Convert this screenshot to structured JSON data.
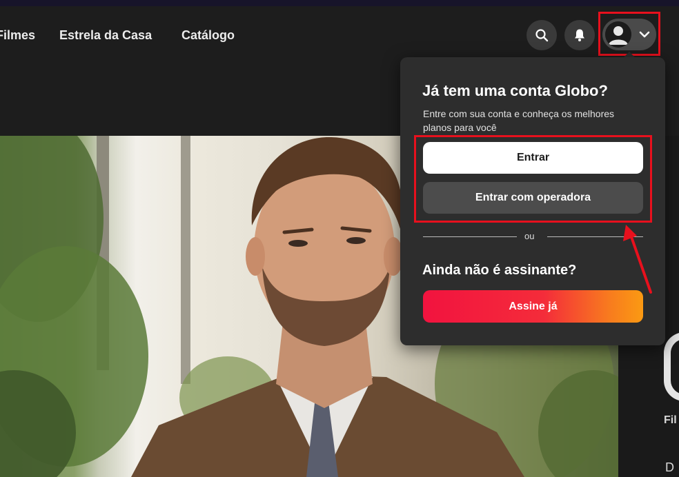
{
  "nav": {
    "links": [
      "Filmes",
      "Estrela da Casa",
      "Catálogo"
    ]
  },
  "header_icons": {
    "search": "search-icon",
    "notifications": "bell-icon",
    "profile": "user-avatar-icon",
    "profile_menu": "chevron-down-icon"
  },
  "login_dropdown": {
    "title": "Já tem uma conta Globo?",
    "subtitle": "Entre com sua conta e conheça os melhores planos para você",
    "login_button": "Entrar",
    "operator_button": "Entrar com operadora",
    "separator": "ou",
    "subscribe_question": "Ainda não é assinante?",
    "subscribe_button": "Assine já"
  },
  "side_panel": {
    "partial_texts": [
      "Fil",
      "D"
    ]
  },
  "colors": {
    "highlight": "#e8101d",
    "subscribe_gradient_start": "#f2133f",
    "subscribe_gradient_end": "#fb9a12",
    "dropdown_bg": "#2d2d2d",
    "navbar_bg": "#1d1d1d"
  }
}
